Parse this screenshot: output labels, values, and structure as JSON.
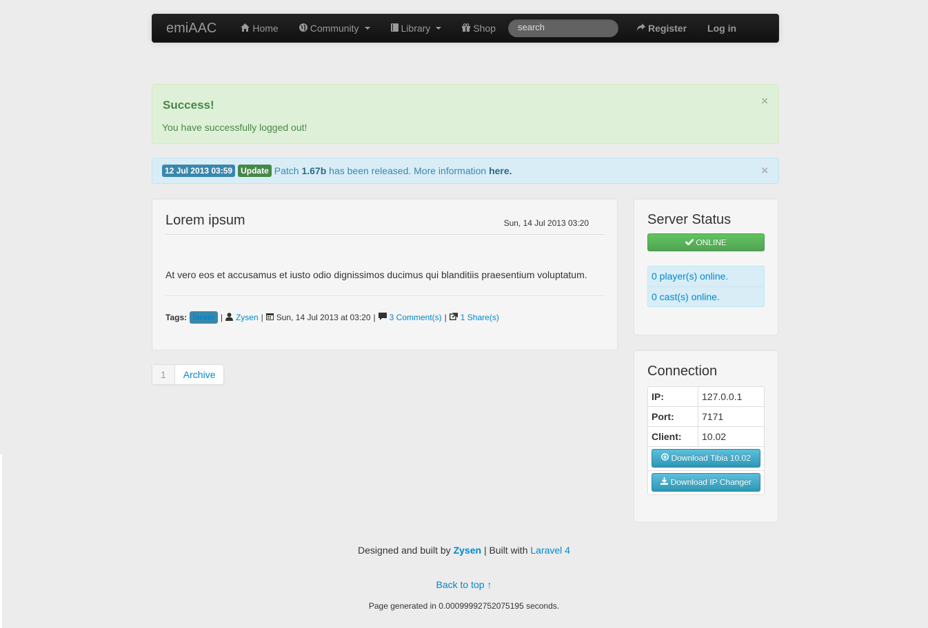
{
  "navbar": {
    "brand": "emiAAC",
    "items": [
      {
        "label": "Home",
        "icon": "home-icon"
      },
      {
        "label": "Community",
        "icon": "globe-icon"
      },
      {
        "label": "Library",
        "icon": "book-icon"
      },
      {
        "label": "Shop",
        "icon": "gift-icon"
      }
    ],
    "search_placeholder": "search",
    "register_label": "Register",
    "login_label": "Log in"
  },
  "alerts": {
    "success_title": "Success!",
    "success_message": "You have successfully logged out!",
    "info_date": "12 Jul 2013 03:59",
    "info_badge": "Update",
    "info_prefix": "Patch",
    "info_version": "1.67b",
    "info_middle": "has been released. More information",
    "info_link": "here."
  },
  "post": {
    "title": "Lorem ipsum",
    "date": "Sun, 14 Jul 2013 03:20",
    "body": "At vero eos et accusamus et iusto odio dignissimos ducimus qui blanditiis praesentium voluptatum.",
    "tags_label": "Tags:",
    "tag": "lorem",
    "author": "Zysen",
    "meta_date": "Sun, 14 Jul 2013 at 03:20",
    "comments": "3 Comment(s)",
    "shares": "1 Share(s)"
  },
  "pagination": {
    "page": "1",
    "archive": "Archive"
  },
  "server_status": {
    "title": "Server Status",
    "status": "ONLINE",
    "players": "0 player(s) online.",
    "casts": "0 cast(s) online."
  },
  "connection": {
    "title": "Connection",
    "rows": [
      {
        "key": "IP:",
        "value": "127.0.0.1"
      },
      {
        "key": "Port:",
        "value": "7171"
      },
      {
        "key": "Client:",
        "value": "10.02"
      }
    ],
    "download_client": "Download Tibia 10.02",
    "download_ipchanger": "Download IP Changer"
  },
  "footer": {
    "designed_prefix": "Designed and built by",
    "designer": "Zysen",
    "built_with_prefix": "| Built with",
    "framework": "Laravel 4",
    "back_to_top": "Back to top ↑",
    "generated": "Page generated in 0.00099992752075195 seconds."
  },
  "colors": {
    "navbar_bg": "#1b1b1b",
    "success_bg": "#dff0d8",
    "info_bg": "#d9edf7",
    "online_green": "#5bb75b",
    "download_blue": "#49afcd",
    "link": "#0088cc"
  }
}
